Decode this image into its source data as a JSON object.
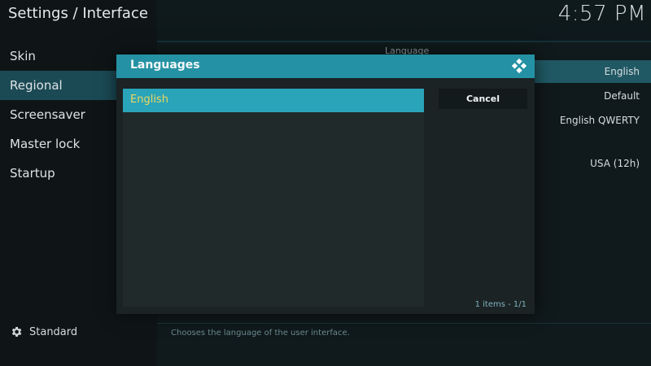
{
  "header": {
    "title": "Settings / Interface",
    "clock": "4:57 PM"
  },
  "sidebar": {
    "items": [
      {
        "label": "Skin"
      },
      {
        "label": "Regional"
      },
      {
        "label": "Screensaver"
      },
      {
        "label": "Master lock"
      },
      {
        "label": "Startup"
      }
    ],
    "selected": "Regional",
    "profile_label": "Standard"
  },
  "settings": {
    "group_label": "Language",
    "values": [
      "English",
      "Default",
      "English QWERTY",
      "USA (12h)"
    ],
    "description": "Chooses the language of the user interface."
  },
  "dialog": {
    "title": "Languages",
    "items": [
      {
        "label": "English"
      }
    ],
    "cancel_label": "Cancel",
    "item_count": "1 items - 1/1"
  },
  "colors": {
    "accent": "#2492a4",
    "selected_item": "#2aa4b9",
    "selected_text": "#ecd65f"
  }
}
